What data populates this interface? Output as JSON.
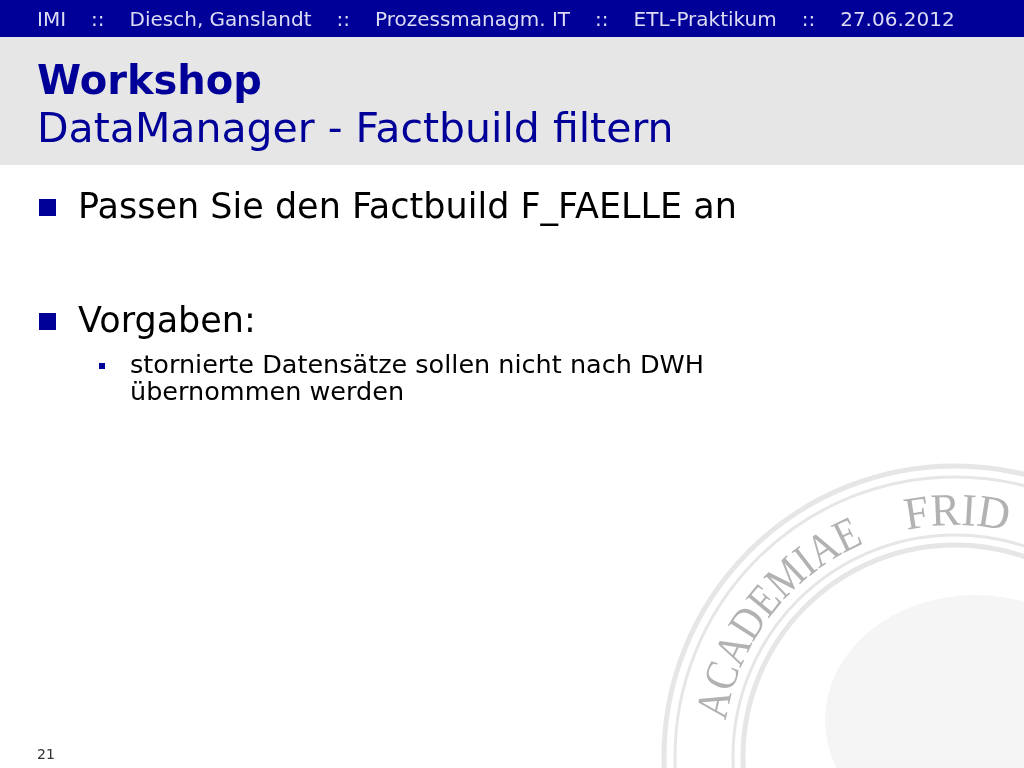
{
  "header": {
    "segments": [
      {
        "kind": "label",
        "text": "IMI"
      },
      {
        "kind": "separator",
        "text": "::"
      },
      {
        "kind": "label",
        "text": "Diesch, Ganslandt"
      },
      {
        "kind": "separator",
        "text": "::"
      },
      {
        "kind": "label",
        "text": "Prozessmanagm. IT"
      },
      {
        "kind": "separator",
        "text": "::"
      },
      {
        "kind": "label",
        "text": "ETL-Praktikum"
      },
      {
        "kind": "separator",
        "text": "::"
      },
      {
        "kind": "label",
        "text": "27.06.2012"
      }
    ]
  },
  "title": {
    "heading": "Workshop",
    "subtitle": "DataManager - Factbuild filtern"
  },
  "bullets": [
    {
      "text": "Passen Sie den Factbuild F_FAELLE an"
    },
    {
      "text": "Vorgaben:",
      "children": [
        {
          "text": "stornierte Datensätze sollen nicht nach DWH übernommen werden"
        }
      ]
    }
  ],
  "seal": {
    "inscriptions": [
      "ACADEMIAE",
      "FRID"
    ]
  },
  "page_number": "21"
}
